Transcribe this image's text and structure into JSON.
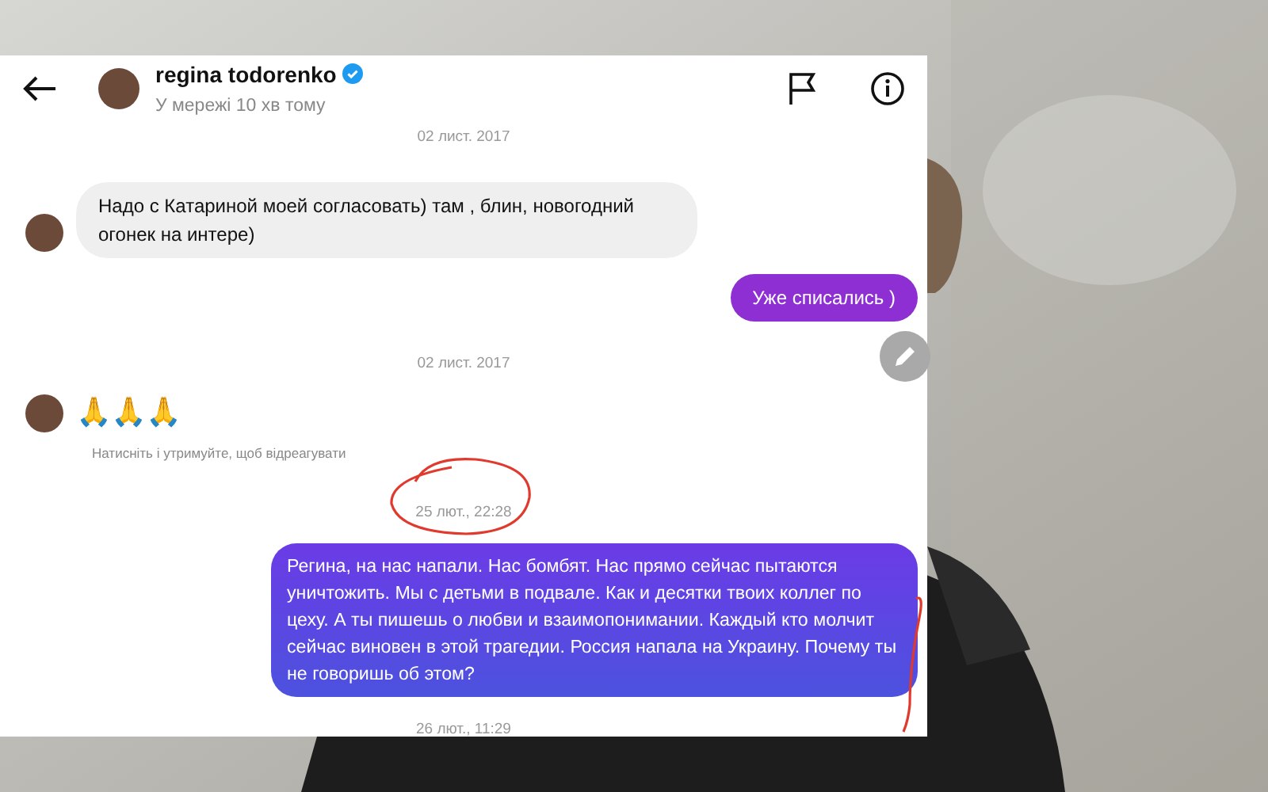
{
  "header": {
    "name": "regina todorenko",
    "verified": true,
    "status": "У мережі 10 хв тому"
  },
  "messages": [
    {
      "kind": "date",
      "text": "02 лист. 2017"
    },
    {
      "kind": "incoming",
      "text": "Надо с Катариной моей согласовать) там , блин, новогодний огонек на интере)"
    },
    {
      "kind": "outgoing",
      "text": "Уже списались )"
    },
    {
      "kind": "date",
      "text": "02 лист. 2017"
    },
    {
      "kind": "emoji",
      "text": "🙏🙏🙏",
      "hint": "Натисніть і утримуйте, щоб відреагувати"
    },
    {
      "kind": "date",
      "text": "25 лют., 22:28"
    },
    {
      "kind": "outgoing_long",
      "text": "Регина, на нас напали. Нас бомбят. Нас прямо сейчас пытаются уничтожить. Мы с детьми в подвале. Как и десятки твоих коллег по цеху. А ты пишешь о любви и взаимопонимании. Каждый кто молчит сейчас виновен в этой трагедии. Россия напала на Украину. Почему ты не говоришь об этом?"
    },
    {
      "kind": "date",
      "text": "26 лют., 11:29"
    }
  ]
}
